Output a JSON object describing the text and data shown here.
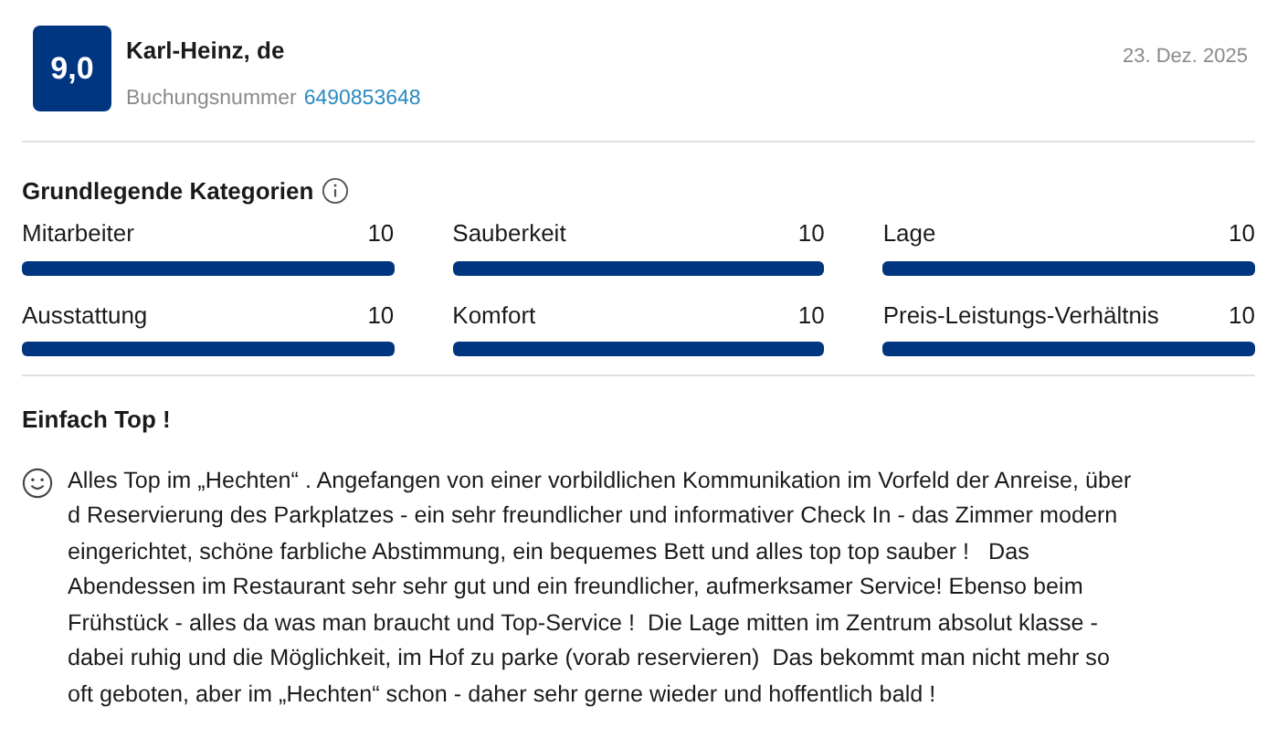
{
  "review": {
    "score": "9,0",
    "reviewer": "Karl-Heinz, de",
    "booking_label": "Buchungsnummer",
    "booking_number": "6490853648",
    "date": "23. Dez. 2025"
  },
  "categories": {
    "title": "Grundlegende Kategorien",
    "items": [
      {
        "label": "Mitarbeiter",
        "value": "10",
        "level": 1
      },
      {
        "label": "Sauberkeit",
        "value": "10",
        "level": 1
      },
      {
        "label": "Lage",
        "value": "10",
        "level": 1
      },
      {
        "label": "Ausstattung",
        "value": "10",
        "level": 1
      },
      {
        "label": "Komfort",
        "value": "10",
        "level": 1
      },
      {
        "label": "Preis-Leistungs-Verhältnis",
        "value": "10",
        "level": 1
      }
    ]
  },
  "comment": {
    "title": "Einfach Top !",
    "lines": [
      "Alles Top im „Hechten“ . Angefangen von einer vorbildlichen Kommunikation im Vorfeld der Anreise, über",
      "d Reservierung des Parkplatzes - ein sehr freundlicher und informativer Check In - das Zimmer modern",
      "eingerichtet, schöne farbliche Abstimmung, ein bequemes Bett und alles top top sauber !   Das",
      "Abendessen im Restaurant sehr sehr gut und ein freundlicher, aufmerksamer Service! Ebenso beim",
      "Frühstück - alles da was man braucht und Top-Service !  Die Lage mitten im Zentrum absolut klasse -",
      "dabei ruhig und die Möglichkeit, im Hof zu parke (vorab reservieren)  Das bekommt man nicht mehr so",
      "oft geboten, aber im „Hechten“ schon - daher sehr gerne wieder und hoffentlich bald !"
    ]
  }
}
